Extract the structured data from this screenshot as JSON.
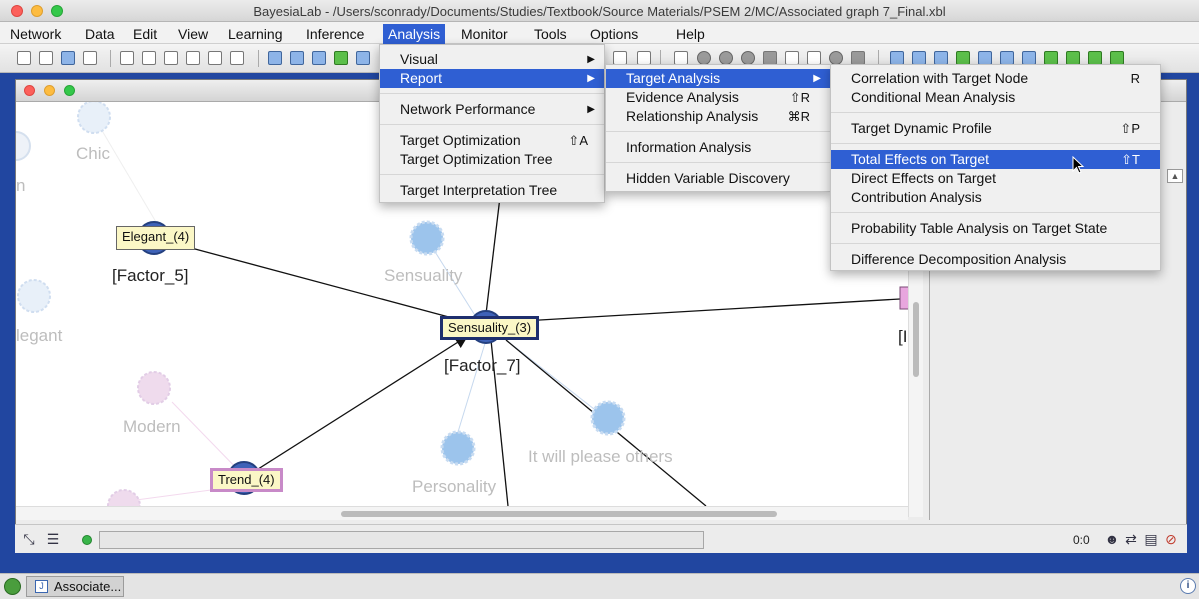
{
  "window": {
    "title": "BayesiaLab - /Users/sconrady/Documents/Studies/Textbook/Source Materials/PSEM 2/MC/Associated graph 7_Final.xbl"
  },
  "menubar": [
    "Network",
    "Data",
    "Edit",
    "View",
    "Learning",
    "Inference",
    "Analysis",
    "Monitor",
    "Tools",
    "Options",
    "Help"
  ],
  "analysis_menu": {
    "items": [
      {
        "label": "Visual",
        "shortcut": "",
        "submenu": true
      },
      {
        "label": "Report",
        "shortcut": "",
        "submenu": true
      },
      {
        "label": "Network Performance",
        "shortcut": "",
        "submenu": true
      },
      {
        "label": "Target Optimization",
        "shortcut": "⇧A",
        "submenu": false
      },
      {
        "label": "Target Optimization Tree",
        "shortcut": "",
        "submenu": false
      },
      {
        "label": "Target Interpretation Tree",
        "shortcut": "",
        "submenu": false
      }
    ]
  },
  "report_menu": {
    "items": [
      {
        "label": "Target Analysis",
        "shortcut": "",
        "submenu": true
      },
      {
        "label": "Evidence Analysis",
        "shortcut": "⇧R",
        "submenu": false
      },
      {
        "label": "Relationship Analysis",
        "shortcut": "⌘R",
        "submenu": false
      },
      {
        "label": "Information Analysis",
        "shortcut": "",
        "submenu": false
      },
      {
        "label": "Hidden Variable Discovery",
        "shortcut": "",
        "submenu": false
      }
    ]
  },
  "target_analysis_menu": {
    "items": [
      {
        "label": "Correlation with Target Node",
        "shortcut": "R"
      },
      {
        "label": "Conditional Mean Analysis",
        "shortcut": ""
      },
      {
        "label": "Target Dynamic Profile",
        "shortcut": "⇧P"
      },
      {
        "label": "Total Effects on Target",
        "shortcut": "⇧T"
      },
      {
        "label": "Direct Effects on Target",
        "shortcut": ""
      },
      {
        "label": "Contribution Analysis",
        "shortcut": ""
      },
      {
        "label": "Probability Table Analysis on Target State",
        "shortcut": ""
      },
      {
        "label": "Difference Decomposition Analysis",
        "shortcut": ""
      }
    ]
  },
  "graph": {
    "tags": {
      "elegant": "Elegant_(4)",
      "sensuality": "Sensuality_(3)",
      "trend": "Trend_(4)"
    },
    "factor_labels": {
      "factor5": "[Factor_5]",
      "factor7": "[Factor_7]",
      "partial": "[I"
    },
    "faint_labels": {
      "chic": "Chic",
      "n": "n",
      "elegant": "legant",
      "sensuality": "Sensuality",
      "modern": "Modern",
      "personality": "Personality",
      "please_others": "It will please others"
    }
  },
  "status": {
    "zoom": "0:0"
  },
  "taskbar": {
    "window_button": "Associate..."
  },
  "colors": {
    "selection": "#2f5fd3",
    "desktop": "#2146a0",
    "tag_fill": "#fbf7c6"
  }
}
